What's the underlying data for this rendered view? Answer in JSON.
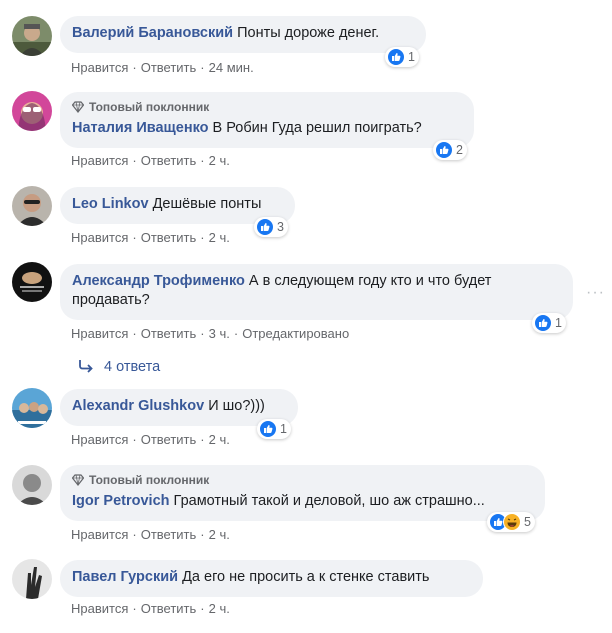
{
  "actions": {
    "like": "Нравится",
    "reply": "Ответить",
    "edited": "Отредактировано"
  },
  "badge_label": "Топовый поклонник",
  "colors": {
    "author": "#385898",
    "bubble": "#f0f2f5",
    "meta": "#65676b",
    "like": "#1877f2"
  },
  "comments": [
    {
      "author": "Валерий Барановский",
      "text": "Понты дороже денег.",
      "time": "24 мин.",
      "reactions": {
        "icons": [
          "like-icon"
        ],
        "count": "1"
      }
    },
    {
      "badge": true,
      "author": "Наталия Иващенко",
      "text": "В Робин Гуда решил поиграть?",
      "time": "2 ч.",
      "reactions": {
        "icons": [
          "like-icon"
        ],
        "count": "2"
      }
    },
    {
      "author": "Leo Linkov",
      "text": "Дешёвые понты",
      "time": "2 ч.",
      "reactions": {
        "icons": [
          "like-icon"
        ],
        "count": "3"
      }
    },
    {
      "author": "Александр Трофименко",
      "text_line1": "А в следующем году кто и что будет",
      "text_line2": "продавать?",
      "time": "3 ч.",
      "edited": true,
      "reactions": {
        "icons": [
          "like-icon"
        ],
        "count": "1"
      },
      "replies_label": "4 ответа"
    },
    {
      "author": "Alexandr Glushkov",
      "text": "И шо?)))",
      "time": "2 ч.",
      "reactions": {
        "icons": [
          "like-icon"
        ],
        "count": "1"
      }
    },
    {
      "badge": true,
      "author": "Igor Petrovich",
      "text": "Грамотный такой и деловой, шо аж страшно...",
      "time": "2 ч.",
      "reactions": {
        "icons": [
          "like-icon",
          "haha-icon"
        ],
        "count": "5"
      }
    },
    {
      "author": "Павел Гурский",
      "text": "Да его не просить а к стенке ставить",
      "time": "2 ч."
    }
  ]
}
